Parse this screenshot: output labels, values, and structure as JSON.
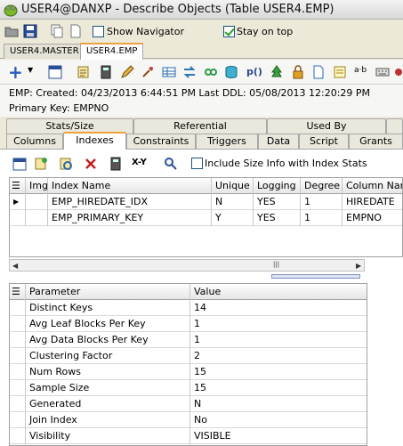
{
  "window": {
    "title": "USER4@DANXP - Describe Objects (Table USER4.EMP)"
  },
  "toolbar1": {
    "show_navigator_label": "Show Navigator",
    "show_navigator_checked": false,
    "stay_on_top_label": "Stay on top",
    "stay_on_top_checked": true
  },
  "doc_tabs": [
    {
      "label": "USER4.MASTER",
      "active": false
    },
    {
      "label": "USER4.EMP",
      "active": true
    }
  ],
  "toolbar2": {
    "p0_label": "p()",
    "ab_label": "a·b"
  },
  "info": {
    "created_line": "EMP:   Created: 04/23/2013 6:44:51 PM   Last DDL: 05/08/2013 12:20:29 PM",
    "primary_key_line": "Primary Key:  EMPNO"
  },
  "section_tabs_top": [
    "Stats/Size",
    "Referential",
    "Used By"
  ],
  "section_tabs_bottom": [
    "Columns",
    "Indexes",
    "Constraints",
    "Triggers",
    "Data",
    "Script",
    "Grants"
  ],
  "active_section_tab": "Indexes",
  "index_tools": {
    "xy_label": "X-Y",
    "include_size_label": "Include Size Info with Index Stats",
    "include_size_checked": false
  },
  "index_grid": {
    "headers": [
      "Img",
      "Index Name",
      "Unique",
      "Logging",
      "Degree",
      "Column Name"
    ],
    "rows": [
      {
        "img": "",
        "name": "EMP_HIREDATE_IDX",
        "unique": "N",
        "logging": "YES",
        "degree": "1",
        "column": "HIREDATE"
      },
      {
        "img": "",
        "name": "EMP_PRIMARY_KEY",
        "unique": "Y",
        "logging": "YES",
        "degree": "1",
        "column": "EMPNO"
      }
    ]
  },
  "scroll_grip": "|||",
  "param_grid": {
    "headers": [
      "Parameter",
      "Value"
    ],
    "rows": [
      {
        "param": "Distinct Keys",
        "value": "14"
      },
      {
        "param": "Avg Leaf Blocks Per Key",
        "value": "1"
      },
      {
        "param": "Avg Data Blocks Per Key",
        "value": "1"
      },
      {
        "param": "Clustering Factor",
        "value": "2"
      },
      {
        "param": "Num Rows",
        "value": "15"
      },
      {
        "param": "Sample Size",
        "value": "15"
      },
      {
        "param": "Generated",
        "value": "N"
      },
      {
        "param": "Join Index",
        "value": "No"
      },
      {
        "param": "Visibility",
        "value": "VISIBLE"
      }
    ]
  }
}
